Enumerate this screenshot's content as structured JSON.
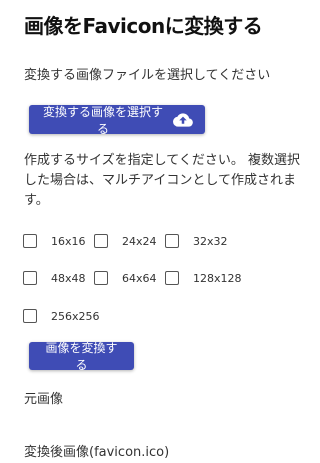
{
  "header": {
    "title": "画像をFaviconに変換する"
  },
  "file_section": {
    "instruction": "変換する画像ファイルを選択してください",
    "select_button_label": "変換する画像を選択する",
    "select_button_icon": "cloud-upload-icon"
  },
  "size_section": {
    "instruction": "作成するサイズを指定してください。 複数選択した場合は、マルチアイコンとして作成されます。",
    "options": [
      {
        "label": "16x16",
        "checked": false
      },
      {
        "label": "24x24",
        "checked": false
      },
      {
        "label": "32x32",
        "checked": false
      },
      {
        "label": "48x48",
        "checked": false
      },
      {
        "label": "64x64",
        "checked": false
      },
      {
        "label": "128x128",
        "checked": false
      },
      {
        "label": "256x256",
        "checked": false
      }
    ]
  },
  "convert_button_label": "画像を変換する",
  "original_image_label": "元画像",
  "converted_image_label": "変換後画像(favicon.ico)",
  "colors": {
    "accent": "#3f4cb5"
  }
}
